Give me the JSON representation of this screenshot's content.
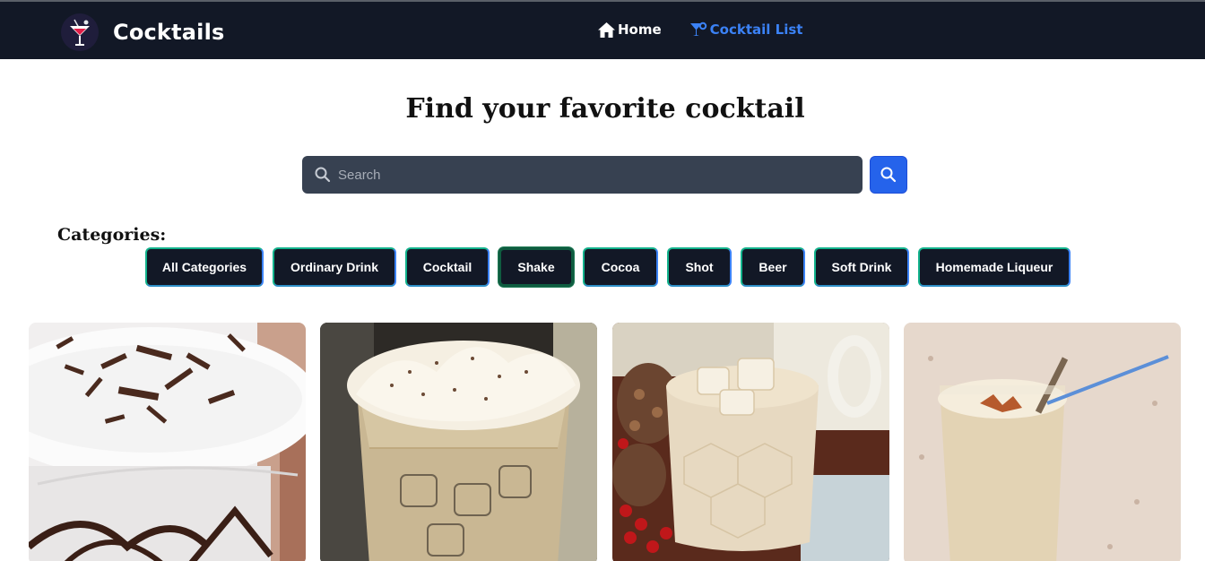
{
  "brand": {
    "name": "Cocktails",
    "logo_icon": "cocktail-glass-icon"
  },
  "nav": [
    {
      "label": "Home",
      "icon": "home-icon"
    },
    {
      "label": "Cocktail List",
      "icon": "cocktail-icon",
      "color": "#3b82f6"
    }
  ],
  "page": {
    "title": "Find your favorite cocktail"
  },
  "search": {
    "placeholder": "Search",
    "value": "",
    "icon": "search-icon"
  },
  "categories": {
    "label": "Categories:",
    "items": [
      "All Categories",
      "Ordinary Drink",
      "Cocktail",
      "Shake",
      "Cocoa",
      "Shot",
      "Beer",
      "Soft Drink",
      "Homemade Liqueur"
    ],
    "selected": "Shake"
  },
  "cards": [
    {
      "image": "chocolate-shake-photo"
    },
    {
      "image": "cream-cocktail-photo"
    },
    {
      "image": "white-russian-photo"
    },
    {
      "image": "milk-drink-photo"
    }
  ],
  "colors": {
    "navbar": "#121826",
    "accent": "#2563eb",
    "button_bg": "#121826",
    "button_border": "#12b28c"
  }
}
